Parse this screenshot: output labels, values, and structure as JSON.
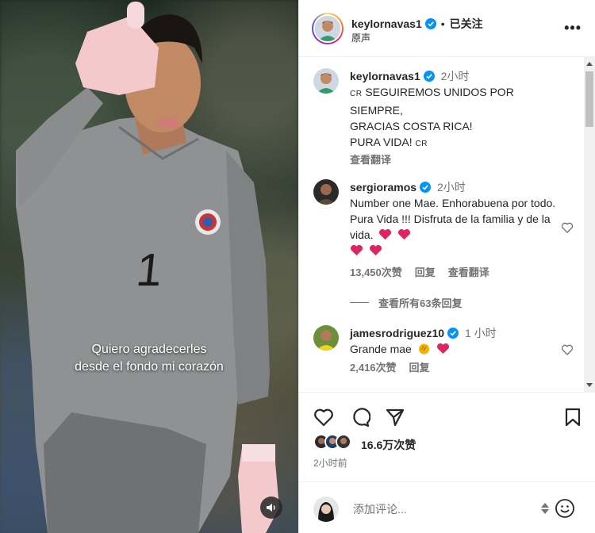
{
  "video": {
    "caption_line1": "Quiero agradecerles",
    "caption_line2": "desde el fondo mi corazón",
    "jersey_number": "1",
    "sound_icon": "speaker-icon"
  },
  "header": {
    "username": "keylornavas1",
    "separator": "•",
    "follow_status": "已关注",
    "audio_label": "原声",
    "more_icon": "more-icon",
    "more_label": "•••"
  },
  "caption_post": {
    "username": "keylornavas1",
    "time": "2小时",
    "cr_prefix": "CR",
    "text_line1": " SEGUIREMOS UNIDOS POR SIEMPRE,",
    "text_line2": "GRACIAS COSTA RICA!",
    "text_line3": "PURA VIDA! ",
    "cr_suffix": "CR",
    "translate": "查看翻译"
  },
  "comments": [
    {
      "username": "sergioramos",
      "time": "2小时",
      "text": "Number one Mae. Enhorabuena por todo. Pura Vida !!! Disfruta de la familia y de la vida.",
      "likes": "13,450次赞",
      "reply": "回复",
      "translate": "查看翻译"
    },
    {
      "username": "jamesrodriguez10",
      "time": "1 小时",
      "text": "Grande mae",
      "likes": "2,416次赞",
      "reply": "回复"
    }
  ],
  "view_replies": "查看所有63条回复",
  "actions": {
    "likes_count": "16.6万次赞",
    "post_time": "2小时前"
  },
  "comment_box": {
    "placeholder": "添加评论..."
  },
  "colors": {
    "verified": "#0095f6",
    "heart_red": "#e0245e",
    "muted": "#737373",
    "jersey": "#8f9192"
  }
}
